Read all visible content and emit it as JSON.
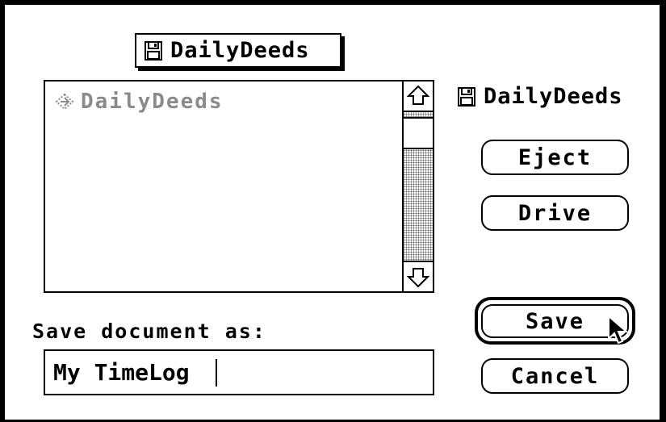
{
  "dialog": {
    "folder_popup": {
      "label": "DailyDeeds",
      "icon": "floppy-disk-icon"
    },
    "file_list": {
      "items": [
        {
          "label": "DailyDeeds",
          "icon": "folder-icon",
          "dimmed": true
        }
      ]
    },
    "volume": {
      "label": "DailyDeeds",
      "icon": "floppy-disk-icon"
    },
    "buttons": {
      "eject": "Eject",
      "drive": "Drive",
      "save": "Save",
      "cancel": "Cancel"
    },
    "save_prompt": "Save document as:",
    "filename_value": "My TimeLog"
  }
}
